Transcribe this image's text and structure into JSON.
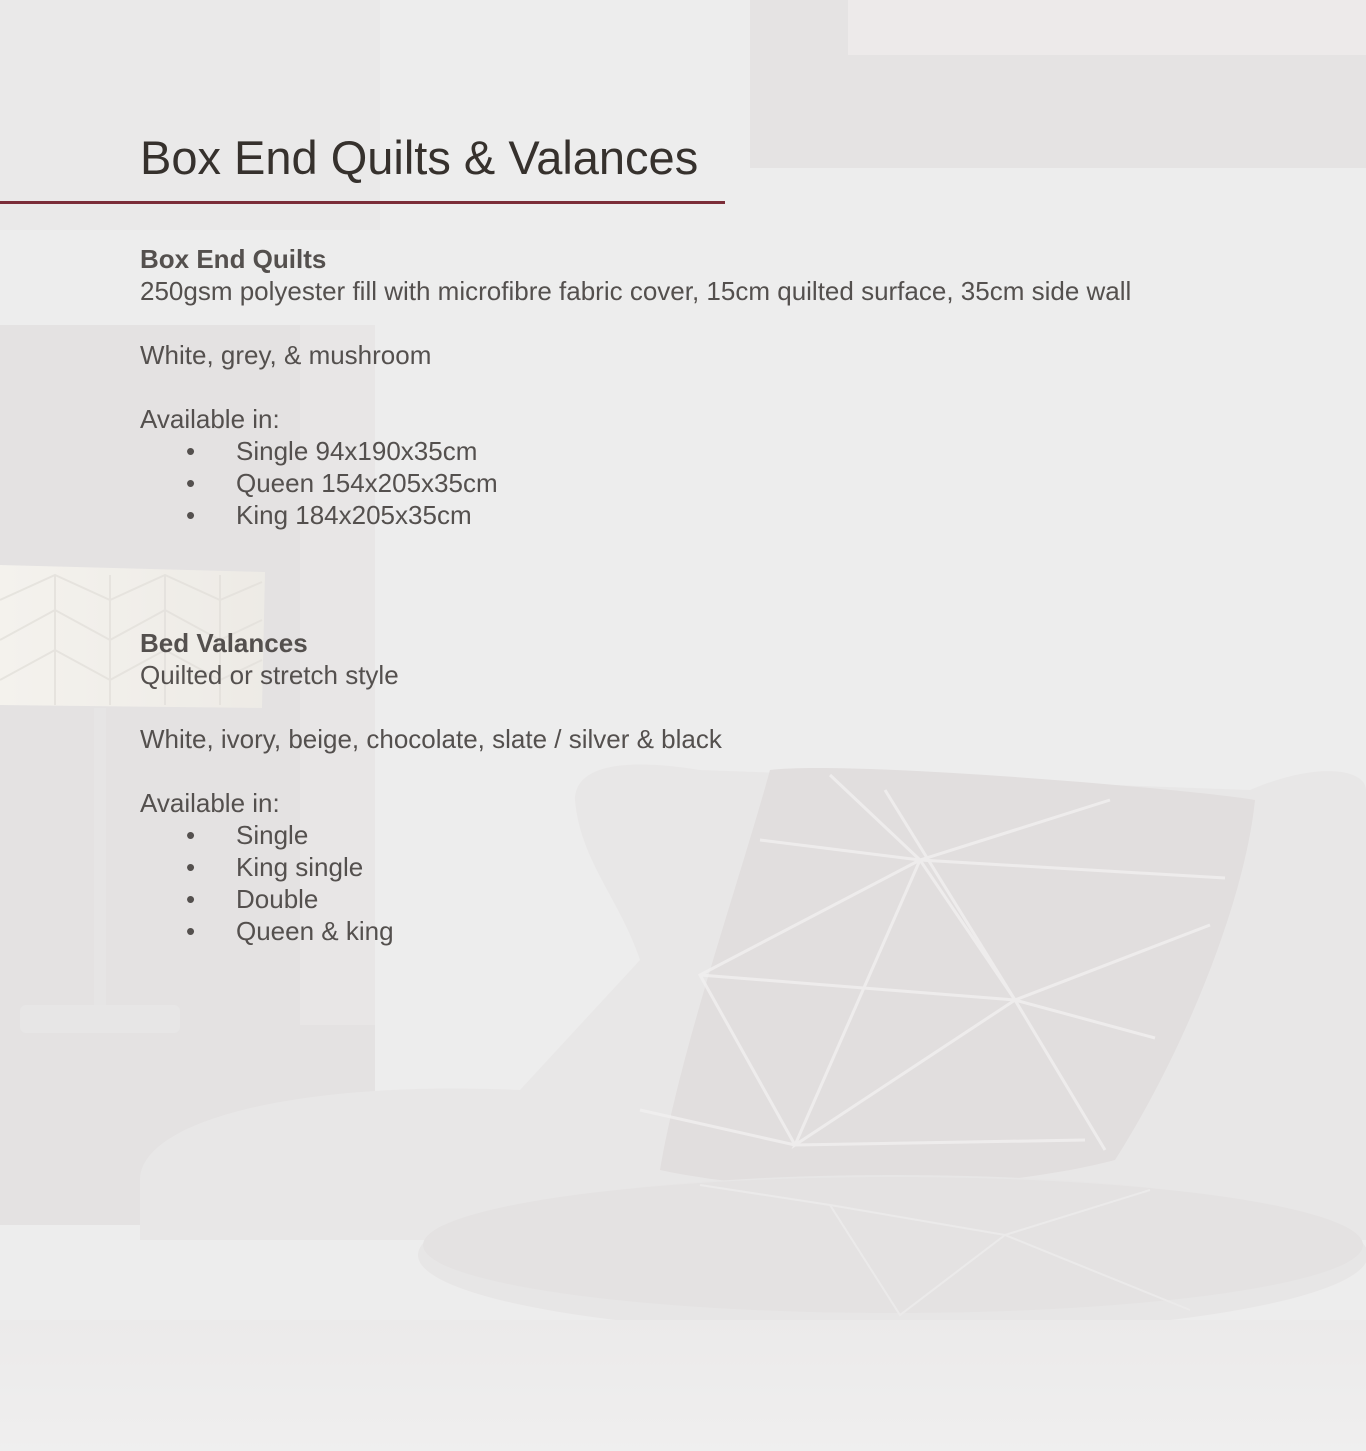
{
  "page": {
    "title": "Box End Quilts & Valances",
    "accent_color": "#7b2d38"
  },
  "sections": [
    {
      "heading": "Box End Quilts",
      "description": "250gsm polyester fill with microfibre fabric cover, 15cm quilted surface, 35cm side wall",
      "colours": "White, grey, & mushroom",
      "available_label": "Available in:",
      "sizes": [
        "Single 94x190x35cm",
        "Queen 154x205x35cm",
        "King 184x205x35cm"
      ]
    },
    {
      "heading": "Bed Valances",
      "description": "Quilted or stretch style",
      "colours": "White, ivory, beige, chocolate, slate / silver & black",
      "available_label": "Available in:",
      "sizes": [
        "Single",
        "King single",
        "Double",
        "Queen & king"
      ]
    }
  ],
  "bullet_glyph": "•"
}
